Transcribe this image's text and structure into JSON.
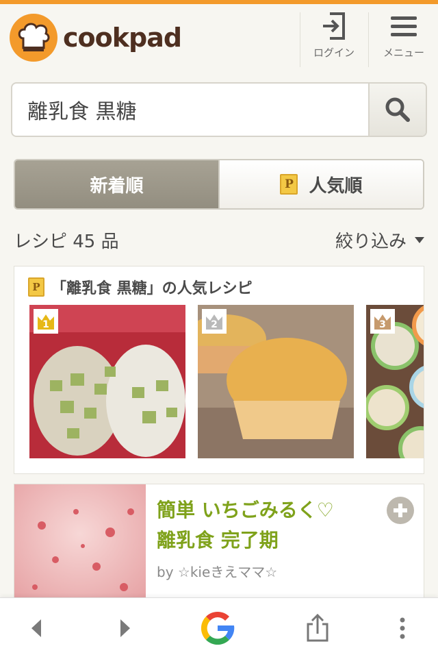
{
  "header": {
    "logo_text": "cookpad",
    "login_label": "ログイン",
    "menu_label": "メニュー"
  },
  "search": {
    "value": "離乳食 黒糖"
  },
  "sort": {
    "newest_label": "新着順",
    "popular_label": "人気順",
    "popular_badge": "P"
  },
  "results": {
    "count_text": "レシピ 45 品",
    "filter_label": "絞り込み"
  },
  "popular": {
    "badge": "P",
    "title": "「離乳食 黒糖」の人気レシピ",
    "ranks": [
      "1",
      "2",
      "3"
    ]
  },
  "recipe": {
    "title_line1": "簡単 いちごみるく♡",
    "title_line2": "離乳食 完了期",
    "author": "by ☆kieきえママ☆"
  },
  "colors": {
    "brand_orange": "#f39a2b",
    "title_green": "#7fa21b",
    "gold": "#e6b817",
    "silver": "#b9b9b9",
    "bronze": "#c69a6d"
  }
}
